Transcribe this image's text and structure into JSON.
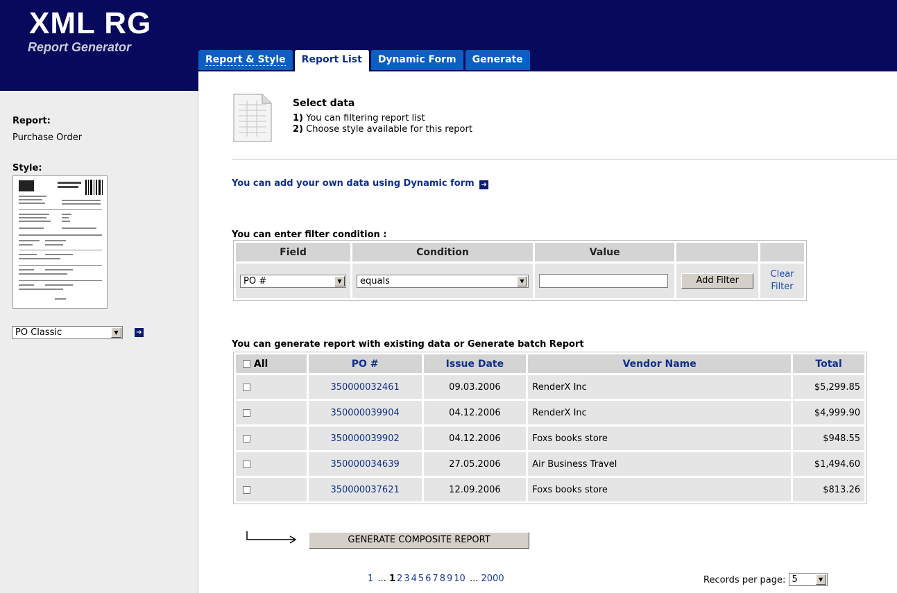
{
  "app": {
    "title": "XML RG",
    "subtitle": "Report Generator"
  },
  "tabs": [
    {
      "label": "Report & Style"
    },
    {
      "label": "Report List"
    },
    {
      "label": "Dynamic Form"
    },
    {
      "label": "Generate"
    }
  ],
  "sidebar": {
    "report_label": "Report:",
    "report_value": "Purchase Order",
    "style_label": "Style:",
    "style_select": "PO Classic"
  },
  "info": {
    "title": "Select data",
    "line1_num": "1)",
    "line1_text": " You can filtering report list",
    "line2_num": "2)",
    "line2_text": " Choose style available for this report"
  },
  "dynamic_link": "You can add your own data using Dynamic form",
  "filter": {
    "title": "You can enter filter condition :",
    "headers": {
      "field": "Field",
      "condition": "Condition",
      "value": "Value"
    },
    "field_value": "PO #",
    "condition_value": "equals",
    "value_input": "",
    "add_button": "Add Filter",
    "clear_line1": "Clear",
    "clear_line2": "Filter"
  },
  "list": {
    "title": "You can generate report with existing data or Generate batch Report",
    "headers": {
      "all": "All",
      "po": "PO #",
      "date": "Issue Date",
      "vendor": "Vendor Name",
      "total": "Total"
    },
    "rows": [
      {
        "po": "350000032461",
        "date": "09.03.2006",
        "vendor": "RenderX Inc",
        "total": "$5,299.85"
      },
      {
        "po": "350000039904",
        "date": "04.12.2006",
        "vendor": "RenderX Inc",
        "total": "$4,999.90"
      },
      {
        "po": "350000039902",
        "date": "04.12.2006",
        "vendor": "Foxs books store",
        "total": "$948.55"
      },
      {
        "po": "350000034639",
        "date": "27.05.2006",
        "vendor": "Air Business Travel",
        "total": "$1,494.60"
      },
      {
        "po": "350000037621",
        "date": "12.09.2006",
        "vendor": "Foxs books store",
        "total": "$813.26"
      }
    ],
    "generate_button": "GENERATE COMPOSITE REPORT"
  },
  "pagination": {
    "first": "1",
    "ellipsis1": "...",
    "current": "1",
    "pages": [
      "2",
      "3",
      "4",
      "5",
      "6",
      "7",
      "8",
      "9",
      "10"
    ],
    "ellipsis2": "...",
    "last": "2000",
    "records_label": "Records per page:",
    "records_value": "5"
  }
}
